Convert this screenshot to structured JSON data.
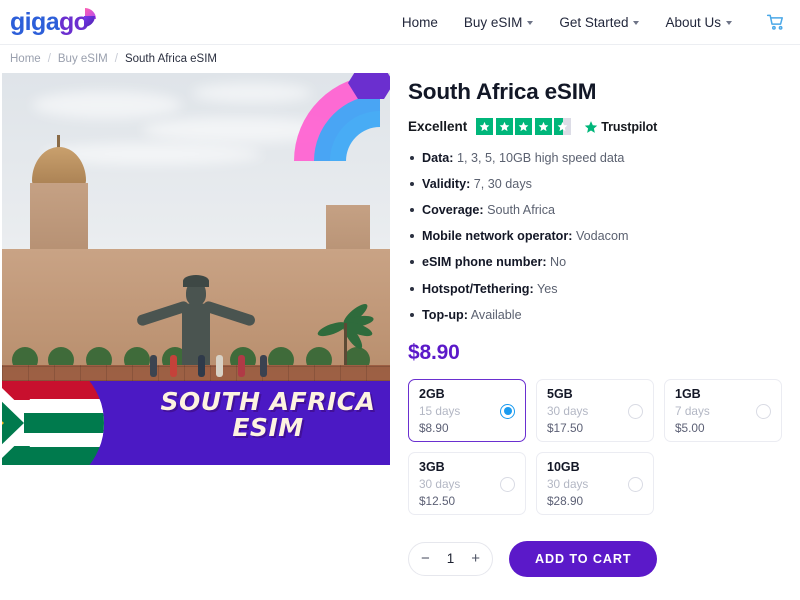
{
  "header": {
    "logo_giga": "giga",
    "logo_go": "go",
    "nav": [
      {
        "label": "Home",
        "has_caret": false
      },
      {
        "label": "Buy eSIM",
        "has_caret": true
      },
      {
        "label": "Get Started",
        "has_caret": true
      },
      {
        "label": "About Us",
        "has_caret": true
      }
    ],
    "cart_icon": "cart-icon"
  },
  "breadcrumb": {
    "items": [
      "Home",
      "Buy eSIM",
      "South Africa eSIM"
    ],
    "separator": "/"
  },
  "gallery": {
    "banner_line1": "SOUTH AFRICA",
    "banner_line2": "ESIM",
    "banner_color": "#4B19C4",
    "banner_text_color": "#FDF3E0"
  },
  "product": {
    "title": "South Africa eSIM",
    "rating": {
      "word": "Excellent",
      "stars_full": 4,
      "stars_half": 1,
      "brand": "Trustpilot",
      "star_color": "#00B67A"
    },
    "specs": [
      {
        "label": "Data:",
        "value": "1, 3, 5, 10GB high speed data"
      },
      {
        "label": "Validity:",
        "value": "7, 30 days"
      },
      {
        "label": "Coverage:",
        "value": "South Africa"
      },
      {
        "label": "Mobile network operator:",
        "value": "Vodacom"
      },
      {
        "label": "eSIM phone number:",
        "value": "No"
      },
      {
        "label": "Hotspot/Tethering:",
        "value": "Yes"
      },
      {
        "label": "Top-up:",
        "value": "Available"
      }
    ],
    "price": "$8.90",
    "price_color": "#5B19C9",
    "plans": [
      {
        "size": "2GB",
        "days": "15 days",
        "price": "$8.90",
        "selected": true
      },
      {
        "size": "5GB",
        "days": "30 days",
        "price": "$17.50",
        "selected": false
      },
      {
        "size": "1GB",
        "days": "7 days",
        "price": "$5.00",
        "selected": false
      },
      {
        "size": "3GB",
        "days": "30 days",
        "price": "$12.50",
        "selected": false
      },
      {
        "size": "10GB",
        "days": "30 days",
        "price": "$28.90",
        "selected": false
      }
    ],
    "quantity": {
      "decrement": "−",
      "value": "1",
      "increment": "+"
    },
    "add_to_cart_label": "ADD TO CART",
    "add_to_cart_color": "#5B19C9"
  }
}
